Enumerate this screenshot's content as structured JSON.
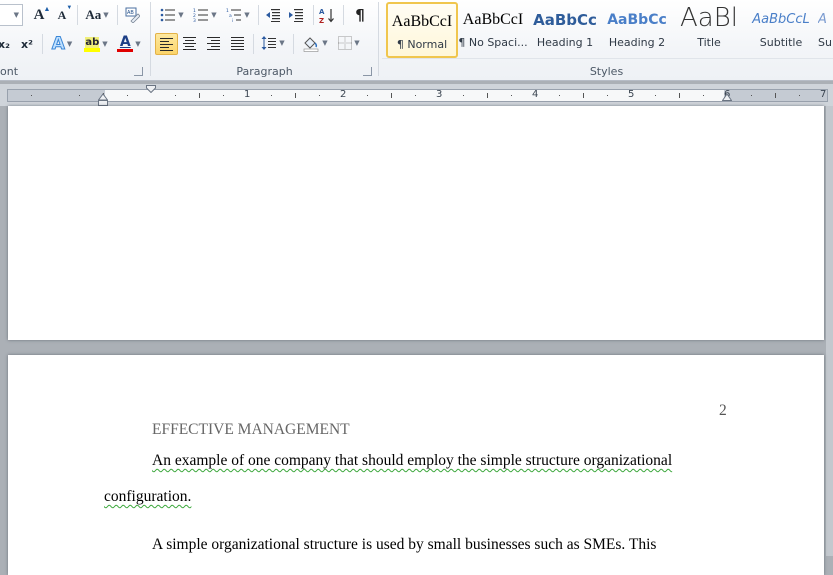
{
  "ribbon": {
    "font_group": {
      "label": "ont",
      "grow_font": "A",
      "shrink_font": "A",
      "change_case": "Aa",
      "subscript": "x₂",
      "superscript": "x²",
      "text_effects": "A",
      "highlight": "ab",
      "font_color": "A",
      "highlight_color": "#ffff00",
      "font_color_value": "#e00000"
    },
    "paragraph_group": {
      "label": "Paragraph",
      "show_marks": "¶",
      "sort": "A↓Z"
    },
    "styles_group": {
      "label": "Styles",
      "styles": [
        {
          "sample": "AaBbCcI",
          "name": "¶ Normal",
          "selected": true
        },
        {
          "sample": "AaBbCcI",
          "name": "¶ No Spaci...",
          "selected": false
        },
        {
          "sample": "AaBbCc",
          "name": "Heading 1",
          "selected": false
        },
        {
          "sample": "AaBbCc",
          "name": "Heading 2",
          "selected": false
        },
        {
          "sample": "AaBl",
          "name": "Title",
          "selected": false
        },
        {
          "sample": "AaBbCcL",
          "name": "Subtitle",
          "selected": false
        },
        {
          "sample": "A",
          "name": "Su",
          "selected": false
        }
      ]
    }
  },
  "ruler": {
    "numbers": [
      "1",
      "1",
      "2",
      "3",
      "4",
      "5",
      "6",
      "7"
    ]
  },
  "document": {
    "page_number": "2",
    "running_head": "EFFECTIVE MANAGEMENT",
    "heading_line1": "An example of one company that should employ the simple  structure organizational",
    "heading_line2": "configuration.",
    "body_line1": "A simple organizational  structure is used by small  businesses such as SMEs. This"
  }
}
